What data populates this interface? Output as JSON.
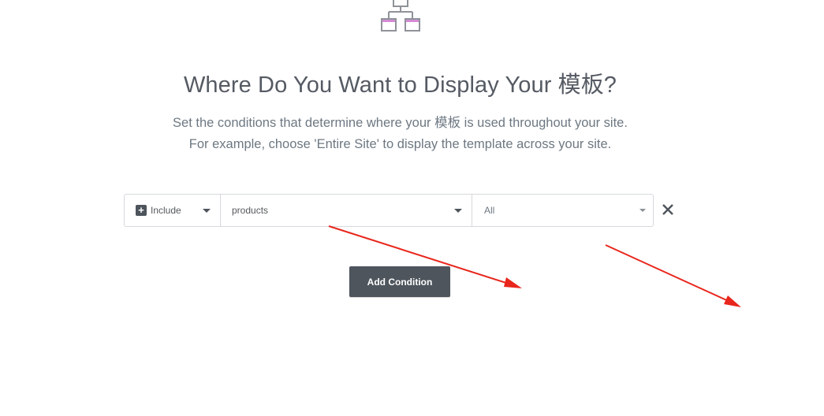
{
  "hero": {
    "icon": "sitemap-icon"
  },
  "heading": {
    "title": "Where Do You Want to Display Your 模板?",
    "subtitle_line1": "Set the conditions that determine where your 模板 is used throughout your site.",
    "subtitle_line2": "For example, choose 'Entire Site' to display the template across your site."
  },
  "condition": {
    "type_icon": "plus-square-icon",
    "type_value": "Include",
    "name_value": "products",
    "sub_value": "All",
    "remove_icon": "close-icon"
  },
  "actions": {
    "add_label": "Add Condition"
  },
  "colors": {
    "annotation_arrow": "#e8261c",
    "button_bg": "#4e555d",
    "text": "#555a63"
  }
}
